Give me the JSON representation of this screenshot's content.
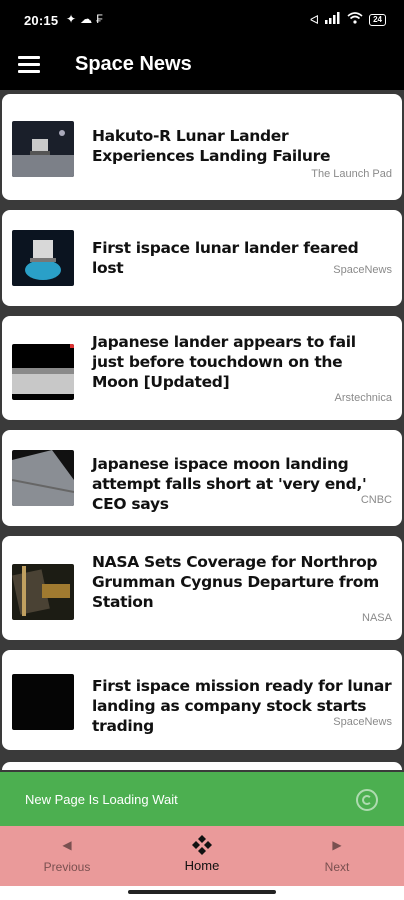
{
  "status_bar": {
    "time": "20:15",
    "left_icons": [
      "bluetooth-off-icon",
      "cloud-icon",
      "app-notification-icon"
    ],
    "right_icons": [
      "bluetooth-icon",
      "signal-icon",
      "wifi-icon"
    ],
    "battery": "24"
  },
  "app_bar": {
    "title": "Space News"
  },
  "articles": [
    {
      "title": "Hakuto-R Lunar Lander Experiences Landing Failure",
      "source": "The Launch Pad"
    },
    {
      "title": "First ispace lunar lander feared lost",
      "source": "SpaceNews"
    },
    {
      "title": "Japanese lander appears to fail just before touchdown on the Moon [Updated]",
      "source": "Arstechnica"
    },
    {
      "title": "Japanese ispace moon landing attempt falls short at 'very end,' CEO says",
      "source": "CNBC"
    },
    {
      "title": "NASA Sets Coverage for Northrop Grumman Cygnus Departure from Station",
      "source": "NASA"
    },
    {
      "title": "First ispace mission ready for lunar landing as company stock starts trading",
      "source": "SpaceNews"
    }
  ],
  "loading": {
    "text": "New Page Is Loading Wait"
  },
  "bottom_nav": {
    "previous_label": "Previous",
    "home_label": "Home",
    "next_label": "Next"
  },
  "colors": {
    "loading_bg": "#4caf50",
    "nav_bg": "#ea9a9a"
  }
}
